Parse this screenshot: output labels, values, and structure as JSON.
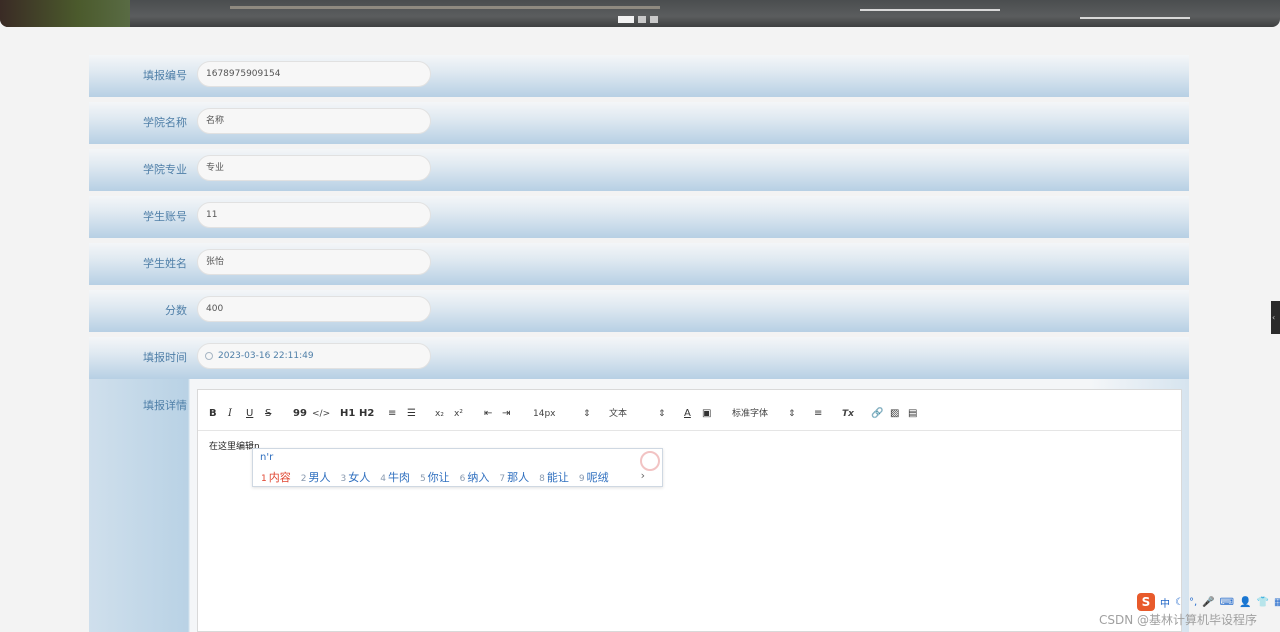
{
  "carousel": {
    "slides": 3,
    "active_index": 0
  },
  "form": {
    "fields": [
      {
        "label": "填报编号",
        "value": "1678975909154"
      },
      {
        "label": "学院名称",
        "value": "名称"
      },
      {
        "label": "学院专业",
        "value": "专业"
      },
      {
        "label": "学生账号",
        "value": "11"
      },
      {
        "label": "学生姓名",
        "value": "张怡"
      },
      {
        "label": "分数",
        "value": "400"
      },
      {
        "label": "填报时间",
        "value": "2023-03-16 22:11:49"
      }
    ],
    "detail_label": "填报详情"
  },
  "editor": {
    "toolbar": {
      "bold": "B",
      "italic": "I",
      "underline": "U",
      "strike": "S",
      "quote": "99",
      "code": "</>",
      "h1": "H1",
      "h2": "H2",
      "sub": "x₂",
      "sup": "x²",
      "size": "14px",
      "para": "文本",
      "font": "标准字体",
      "clean": "Tx"
    },
    "content": "在这里编辑n"
  },
  "ime_popup": {
    "composition": "n'r",
    "candidates": [
      {
        "n": "1",
        "text": "内容"
      },
      {
        "n": "2",
        "text": "男人"
      },
      {
        "n": "3",
        "text": "女人"
      },
      {
        "n": "4",
        "text": "牛肉"
      },
      {
        "n": "5",
        "text": "你让"
      },
      {
        "n": "6",
        "text": "纳入"
      },
      {
        "n": "7",
        "text": "那人"
      },
      {
        "n": "8",
        "text": "能让"
      },
      {
        "n": "9",
        "text": "呢绒"
      }
    ],
    "next": "›"
  },
  "ime_bar": {
    "logo": "S",
    "mode": "中"
  },
  "watermark": "CSDN @基林计算机毕设程序"
}
